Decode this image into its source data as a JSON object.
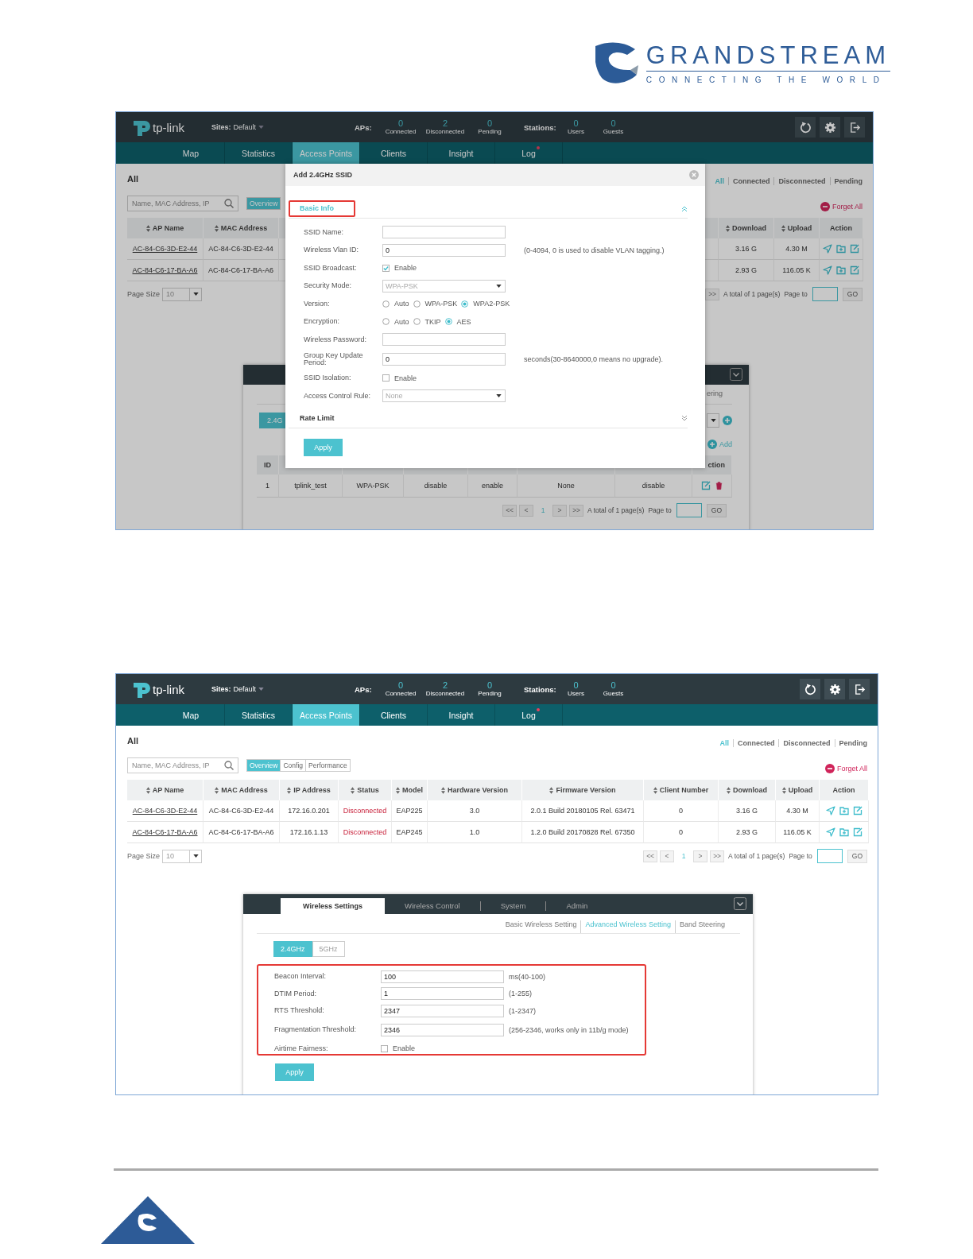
{
  "brand": {
    "name": "GRANDSTREAM",
    "tagline": "CONNECTING THE WORLD"
  },
  "screenshots": [
    {
      "header": {
        "logo": "tp-link",
        "sites_label": "Sites:",
        "sites_value": "Default",
        "aps_label": "APs:",
        "aps": [
          {
            "value": "0",
            "label": "Connected"
          },
          {
            "value": "2",
            "label": "Disconnected"
          },
          {
            "value": "0",
            "label": "Pending"
          }
        ],
        "stations_label": "Stations:",
        "stations": [
          {
            "value": "0",
            "label": "Users"
          },
          {
            "value": "0",
            "label": "Guests"
          }
        ]
      },
      "nav": [
        {
          "label": "Map",
          "selected": false,
          "alert": false
        },
        {
          "label": "Statistics",
          "selected": false,
          "alert": false
        },
        {
          "label": "Access Points",
          "selected": true,
          "alert": false
        },
        {
          "label": "Clients",
          "selected": false,
          "alert": false
        },
        {
          "label": "Insight",
          "selected": false,
          "alert": false
        },
        {
          "label": "Log",
          "selected": false,
          "alert": true
        }
      ],
      "title": "All",
      "filters": [
        {
          "label": "All",
          "selected": true
        },
        {
          "label": "Connected",
          "selected": false
        },
        {
          "label": "Disconnected",
          "selected": false
        },
        {
          "label": "Pending",
          "selected": false
        }
      ],
      "search": {
        "placeholder": "Name, MAC Address, IP"
      },
      "views": [
        {
          "label": "Overview",
          "selected": true
        }
      ],
      "forget_all": "Forget All",
      "table": {
        "columns": [
          {
            "label": "AP Name",
            "kind": "link",
            "sortable": true
          },
          {
            "label": "MAC Address",
            "kind": "text",
            "sortable": true
          },
          {
            "label": "Download",
            "kind": "text",
            "sortable": true,
            "split": true
          },
          {
            "label": "Upload",
            "kind": "text",
            "sortable": true
          },
          {
            "label": "Action",
            "kind": "actions",
            "sortable": false
          }
        ],
        "rows": [
          {
            "cells": [
              "AC-84-C6-3D-E2-44",
              "AC-84-C6-3D-E2-44",
              "3.16 G",
              "4.30 M"
            ]
          },
          {
            "cells": [
              "AC-84-C6-17-BA-A6",
              "AC-84-C6-17-BA-A6",
              "2.93 G",
              "116.05 K"
            ]
          }
        ]
      },
      "page_size": {
        "label": "Page Size",
        "value": "10"
      },
      "pager": {
        "buttons": [
          {
            "label": ">>",
            "selected": false
          }
        ],
        "total": "A total of 1 page(s)",
        "page_to": "Page to",
        "go": "GO"
      },
      "ssid_panel": {
        "link": "ering",
        "band": "2.4G",
        "add": "Add",
        "id_column": "ID",
        "action_column": "ction",
        "rows": [
          {
            "cells": [
              "1",
              "tplink_test",
              "WPA-PSK",
              "disable",
              "enable",
              "None",
              "disable"
            ]
          }
        ],
        "pager": {
          "buttons": [
            {
              "label": "<<",
              "selected": false
            },
            {
              "label": "<",
              "selected": false
            },
            {
              "label": "1",
              "selected": true
            },
            {
              "label": ">",
              "selected": false
            },
            {
              "label": ">>",
              "selected": false
            }
          ],
          "total": "A total of 1 page(s)",
          "page_to": "Page to",
          "go": "GO"
        }
      },
      "modal": {
        "title": "Add 2.4GHz SSID",
        "sections": [
          {
            "title": "Basic Info",
            "expanded": true,
            "highlighted": true,
            "fields": [
              {
                "kind": "input",
                "label": "SSID Name:"
              },
              {
                "kind": "input",
                "label": "Wireless Vlan ID:",
                "value": "0",
                "hint": "(0-4094, 0 is used to disable VLAN tagging.)"
              },
              {
                "kind": "checkbox",
                "label": "SSID Broadcast:",
                "checked": true,
                "text": "Enable"
              },
              {
                "kind": "select",
                "label": "Security Mode:",
                "value": "WPA-PSK"
              },
              {
                "kind": "radios",
                "label": "Version:",
                "options": [
                  {
                    "label": "Auto",
                    "selected": false
                  },
                  {
                    "label": "WPA-PSK",
                    "selected": false
                  },
                  {
                    "label": "WPA2-PSK",
                    "selected": true
                  }
                ]
              },
              {
                "kind": "radios",
                "label": "Encryption:",
                "options": [
                  {
                    "label": "Auto",
                    "selected": false
                  },
                  {
                    "label": "TKIP",
                    "selected": false
                  },
                  {
                    "label": "AES",
                    "selected": true
                  }
                ]
              },
              {
                "kind": "input",
                "label": "Wireless Password:"
              },
              {
                "kind": "input",
                "label": "Group Key Update Period:",
                "value": "0",
                "hint": "seconds(30-8640000,0 means no upgrade)."
              },
              {
                "kind": "checkbox",
                "label": "SSID Isolation:",
                "checked": false,
                "text": "Enable"
              },
              {
                "kind": "select",
                "label": "Access Control Rule:",
                "value": "None"
              }
            ]
          },
          {
            "title": "Rate Limit",
            "expanded": false,
            "highlighted": false
          }
        ],
        "apply": "Apply"
      }
    },
    {
      "header": {
        "logo": "tp-link",
        "sites_label": "Sites:",
        "sites_value": "Default",
        "aps_label": "APs:",
        "aps": [
          {
            "value": "0",
            "label": "Connected"
          },
          {
            "value": "2",
            "label": "Disconnected"
          },
          {
            "value": "0",
            "label": "Pending"
          }
        ],
        "stations_label": "Stations:",
        "stations": [
          {
            "value": "0",
            "label": "Users"
          },
          {
            "value": "0",
            "label": "Guests"
          }
        ]
      },
      "nav": [
        {
          "label": "Map",
          "selected": false,
          "alert": false
        },
        {
          "label": "Statistics",
          "selected": false,
          "alert": false
        },
        {
          "label": "Access Points",
          "selected": true,
          "alert": false
        },
        {
          "label": "Clients",
          "selected": false,
          "alert": false
        },
        {
          "label": "Insight",
          "selected": false,
          "alert": false
        },
        {
          "label": "Log",
          "selected": false,
          "alert": true
        }
      ],
      "title": "All",
      "filters": [
        {
          "label": "All",
          "selected": true
        },
        {
          "label": "Connected",
          "selected": false
        },
        {
          "label": "Disconnected",
          "selected": false
        },
        {
          "label": "Pending",
          "selected": false
        }
      ],
      "search": {
        "placeholder": "Name, MAC Address, IP"
      },
      "views": [
        {
          "label": "Overview",
          "selected": true
        },
        {
          "label": "Config",
          "selected": false
        },
        {
          "label": "Performance",
          "selected": false
        }
      ],
      "forget_all": "Forget All",
      "table": {
        "columns": [
          {
            "label": "AP Name",
            "kind": "link",
            "sortable": true
          },
          {
            "label": "MAC Address",
            "kind": "text",
            "sortable": true
          },
          {
            "label": "IP Address",
            "kind": "text",
            "sortable": true
          },
          {
            "label": "Status",
            "kind": "status",
            "sortable": true
          },
          {
            "label": "Model",
            "kind": "text",
            "sortable": true
          },
          {
            "label": "Hardware Version",
            "kind": "text",
            "sortable": true
          },
          {
            "label": "Firmware Version",
            "kind": "text",
            "sortable": true
          },
          {
            "label": "Client Number",
            "kind": "text",
            "sortable": true
          },
          {
            "label": "Download",
            "kind": "text",
            "sortable": true
          },
          {
            "label": "Upload",
            "kind": "text",
            "sortable": true
          },
          {
            "label": "Action",
            "kind": "actions",
            "sortable": false
          }
        ],
        "rows": [
          {
            "cells": [
              "AC-84-C6-3D-E2-44",
              "AC-84-C6-3D-E2-44",
              "172.16.0.201",
              "Disconnected",
              "EAP225",
              "3.0",
              "2.0.1 Build 20180105 Rel. 63471",
              "0",
              "3.16 G",
              "4.30 M"
            ]
          },
          {
            "cells": [
              "AC-84-C6-17-BA-A6",
              "AC-84-C6-17-BA-A6",
              "172.16.1.13",
              "Disconnected",
              "EAP245",
              "1.0",
              "1.2.0 Build 20170828 Rel. 67350",
              "0",
              "2.93 G",
              "116.05 K"
            ]
          }
        ]
      },
      "page_size": {
        "label": "Page Size",
        "value": "10"
      },
      "pager": {
        "buttons": [
          {
            "label": "<<",
            "selected": false
          },
          {
            "label": "<",
            "selected": false
          },
          {
            "label": "1",
            "selected": true
          },
          {
            "label": ">",
            "selected": false
          },
          {
            "label": ">>",
            "selected": false
          }
        ],
        "total": "A total of 1 page(s)",
        "page_to": "Page to",
        "go": "GO"
      },
      "panel": {
        "tabs": [
          {
            "label": "Wireless Settings",
            "selected": true
          },
          {
            "label": "Wireless Control",
            "selected": false
          },
          {
            "label": "System",
            "selected": false
          },
          {
            "label": "Admin",
            "selected": false
          }
        ],
        "links": [
          {
            "label": "Basic Wireless Setting",
            "selected": false
          },
          {
            "label": "Advanced Wireless Setting",
            "selected": true
          },
          {
            "label": "Band Steering",
            "selected": false
          }
        ],
        "bands": [
          {
            "label": "2.4GHz",
            "selected": true
          },
          {
            "label": "5GHz",
            "selected": false
          }
        ],
        "highlighted": true,
        "fields": [
          {
            "kind": "input",
            "label": "Beacon Interval:",
            "value": "100",
            "hint": "ms(40-100)"
          },
          {
            "kind": "input",
            "label": "DTIM Period:",
            "value": "1",
            "hint": "(1-255)"
          },
          {
            "kind": "input",
            "label": "RTS Threshold:",
            "value": "2347",
            "hint": "(1-2347)"
          },
          {
            "kind": "input",
            "label": "Fragmentation Threshold:",
            "value": "2346",
            "hint": "(256-2346, works only in 11b/g mode)"
          },
          {
            "kind": "checkbox",
            "label": "Airtime Fairness:",
            "checked": false,
            "text": "Enable"
          }
        ],
        "apply": "Apply"
      }
    }
  ]
}
